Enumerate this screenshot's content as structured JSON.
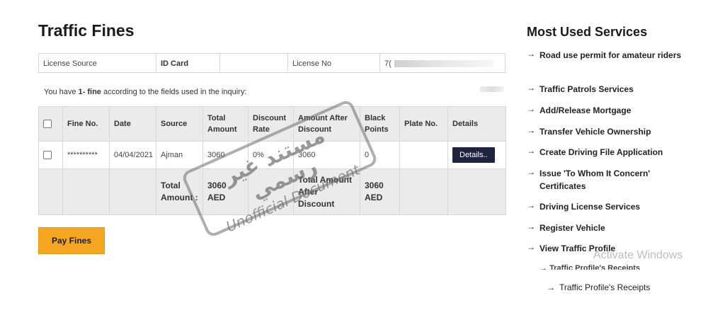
{
  "page": {
    "title": "Traffic Fines"
  },
  "license": {
    "source_label": "License Source",
    "source_value": "ID Card",
    "number_label": "License No",
    "number_value": "7("
  },
  "notice": {
    "prefix": "You have ",
    "count": "1- fine",
    "suffix": " according to the fields used in the inquiry:"
  },
  "table": {
    "headers": [
      "Fine No.",
      "Date",
      "Source",
      "Total Amount",
      "Discount Rate",
      "Amount After Discount",
      "Black Points",
      "Plate No.",
      "Details"
    ],
    "rows": [
      {
        "fine_no": "**********",
        "date": "04/04/2021",
        "source": "Ajman",
        "total": "3060",
        "discount": "0%",
        "after": "3060",
        "points": "0",
        "plate": "",
        "details_label": "Details.."
      }
    ],
    "totals": {
      "total_label": "Total Amount :",
      "total_value": "3060 AED",
      "after_label": "Total Amount After Discount",
      "after_value": "3060 AED"
    }
  },
  "actions": {
    "pay_label": "Pay Fines"
  },
  "stamp": {
    "arabic": "مستند غير رسمي",
    "english": "Unofficial Document"
  },
  "sidebar": {
    "title": "Most Used Services",
    "items": [
      "Road use permit for amateur riders",
      "Traffic Patrols Services",
      "Add/Release Mortgage",
      "Transfer Vehicle Ownership",
      "Create Driving File Application",
      "Issue 'To Whom It Concern' Certificates",
      "Driving License Services",
      "Register Vehicle",
      "View Traffic Profile"
    ],
    "overlap_item": "Traffic Profile's Receipts",
    "last_item": "Traffic Profile's Receipts"
  },
  "os_overlay": {
    "activate": "Activate Windows"
  },
  "icons": {
    "arrow": "→"
  },
  "colors": {
    "pay_button": "#f5a623",
    "details_button": "#1f2340",
    "header_bg": "#ebebeb"
  }
}
